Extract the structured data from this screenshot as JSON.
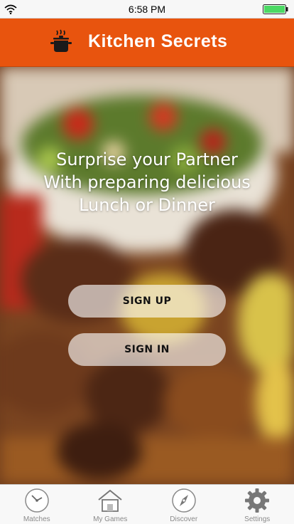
{
  "status_bar": {
    "time": "6:58 PM"
  },
  "header": {
    "title": "Kitchen Secrets",
    "icon": "cooking-pot-icon",
    "color": "#e8540e"
  },
  "hero": {
    "tagline_lines": [
      "Surprise your Partner",
      "With preparing delicious",
      "Lunch or Dinner"
    ]
  },
  "buttons": {
    "sign_up": "SIGN UP",
    "sign_in": "SIGN IN"
  },
  "tabs": [
    {
      "label": "Matches",
      "icon": "clock-icon"
    },
    {
      "label": "My Games",
      "icon": "house-icon"
    },
    {
      "label": "Discover",
      "icon": "compass-icon"
    },
    {
      "label": "Settings",
      "icon": "gear-icon"
    }
  ]
}
